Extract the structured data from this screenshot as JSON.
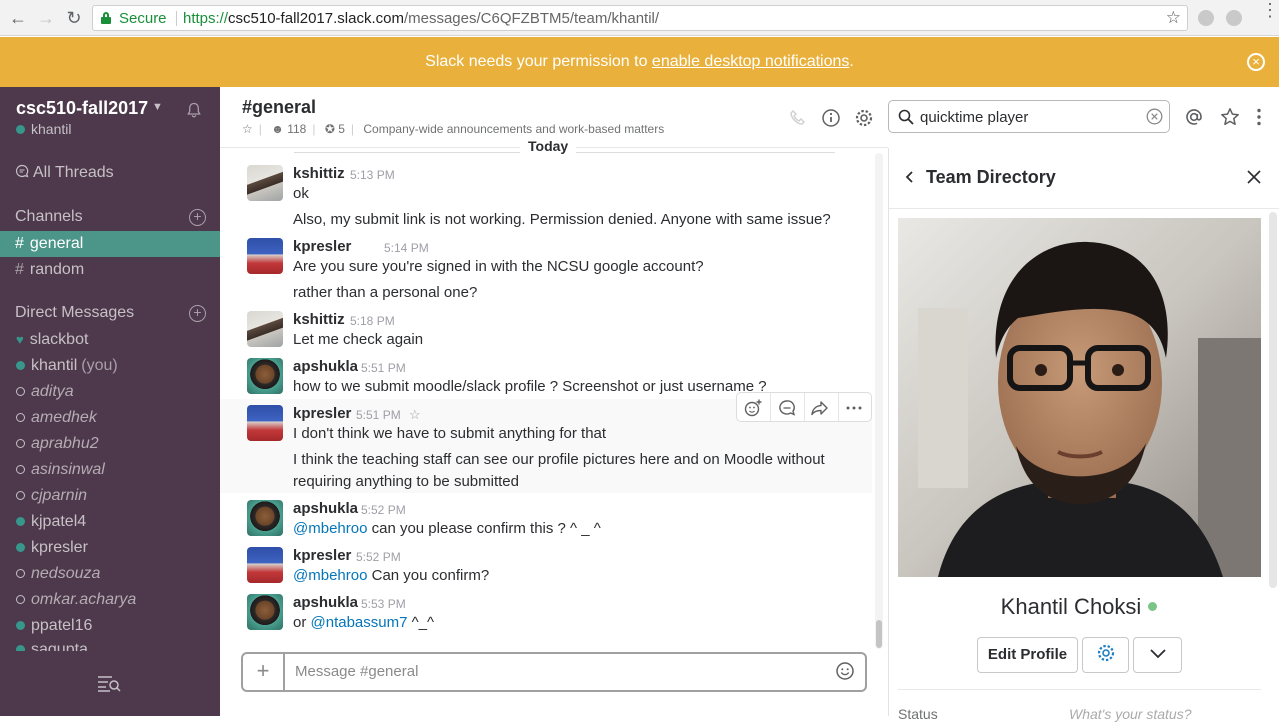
{
  "browser": {
    "secure_label": "Secure",
    "url_scheme": "https://",
    "url_host": "csc510-fall2017.slack.com",
    "url_path": "/messages/C6QFZBTM5/team/khantil/"
  },
  "banner": {
    "text_before": "Slack needs your permission to ",
    "link": "enable desktop notifications",
    "text_after": "."
  },
  "sidebar": {
    "team_name": "csc510-fall2017",
    "user": "khantil",
    "all_threads": "All Threads",
    "channels_header": "Channels",
    "channels": [
      {
        "name": "general",
        "active": true
      },
      {
        "name": "random",
        "active": false
      }
    ],
    "dm_header": "Direct Messages",
    "dms": [
      {
        "name": "slackbot",
        "status": "bot"
      },
      {
        "name": "khantil",
        "suffix": "(you)",
        "status": "online"
      },
      {
        "name": "aditya",
        "status": "away"
      },
      {
        "name": "amedhek",
        "status": "away"
      },
      {
        "name": "aprabhu2",
        "status": "away"
      },
      {
        "name": "asinsinwal",
        "status": "away"
      },
      {
        "name": "cjparnin",
        "status": "away"
      },
      {
        "name": "kjpatel4",
        "status": "online"
      },
      {
        "name": "kpresler",
        "status": "online"
      },
      {
        "name": "nedsouza",
        "status": "away"
      },
      {
        "name": "omkar.acharya",
        "status": "away"
      },
      {
        "name": "ppatel16",
        "status": "online"
      },
      {
        "name": "sagupta",
        "status": "online"
      }
    ]
  },
  "channel": {
    "title": "#general",
    "members": "118",
    "pins": "5",
    "purpose": "Company-wide announcements and work-based matters",
    "day_divider": "Today"
  },
  "messages": [
    {
      "author": "kshittiz",
      "time": "5:13 PM",
      "lines": [
        "ok",
        "Also, my submit link is not working. Permission denied. Anyone with same issue?"
      ]
    },
    {
      "author": "kpresler",
      "time": "5:14 PM",
      "lines": [
        "Are you sure you're signed in with the NCSU google account?",
        "rather than a personal one?"
      ]
    },
    {
      "author": "kshittiz",
      "time": "5:18 PM",
      "lines": [
        "Let me check again"
      ]
    },
    {
      "author": "apshukla",
      "time": "5:51 PM",
      "lines": [
        "how to we submit moodle/slack profile ? Screenshot or just username ?"
      ]
    },
    {
      "author": "kpresler",
      "time": "5:51 PM",
      "lines": [
        "I don't think we have to submit anything for that",
        "I think the teaching staff can see our profile pictures here and on Moodle without",
        "requiring anything to be submitted"
      ]
    },
    {
      "author": "apshukla",
      "time": "5:52 PM",
      "mention": "@mbehroo",
      "rest": " can you please confirm this ? ^ _ ^"
    },
    {
      "author": "kpresler",
      "time": "5:52 PM",
      "mention": "@mbehroo",
      "rest": " Can you confirm?"
    },
    {
      "author": "apshukla",
      "time": "5:53 PM",
      "prefix": "or ",
      "mention": "@ntabassum7",
      "rest": " ^_^"
    }
  ],
  "composer": {
    "placeholder": "Message #general"
  },
  "search": {
    "value": "quicktime player"
  },
  "panel": {
    "title": "Team Directory",
    "profile_name": "Khantil Choksi",
    "edit_profile": "Edit Profile",
    "status_label": "Status",
    "status_placeholder": "What's your status?"
  },
  "colors": {
    "sidebar_bg": "#4d394b",
    "active_channel": "#4c9689",
    "banner": "#e9b13b",
    "mention": "#0576b9",
    "online": "#38978d"
  }
}
